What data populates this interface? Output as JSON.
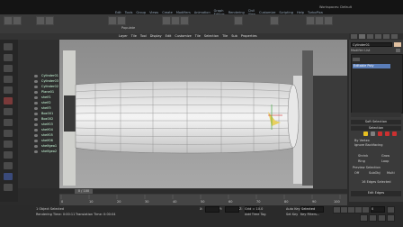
{
  "app": {
    "menu": [
      "Edit",
      "Tools",
      "Group",
      "Views",
      "Create",
      "Modifiers",
      "Animation",
      "Graph Editors",
      "Rendering",
      "Civil View",
      "Customize",
      "Scripting",
      "Help",
      "TurboPixa"
    ],
    "workspace_label": "Workspaces: Default",
    "populate_label": "Populate"
  },
  "viewport_menu": [
    "Layer",
    "Tile",
    "Tool",
    "Display",
    "Edit",
    "Customize",
    "Tile",
    "Selection",
    "Tile",
    "Sub",
    "Properties"
  ],
  "scene_explorer": {
    "items": [
      "Cylinder01",
      "Cylinder03",
      "Cylinder02",
      "Plane01",
      "shelf1",
      "shelf2",
      "shelf3",
      "Box001",
      "Box002",
      "shelf03",
      "shelf04",
      "shelf05",
      "shelf06",
      "shelfgeo1",
      "shelfgeo2"
    ]
  },
  "command_panel": {
    "object_name": "Cylinder01",
    "modifier_list_label": "Modifier List",
    "stack_selected": "Editable Poly",
    "soft_selection": "Soft Selection",
    "selection": "Selection",
    "by_vertex": "By Vertex",
    "ignore_backfacing": "Ignore Backfacing",
    "shrink": "Shrink",
    "grow": "Grow",
    "ring": "Ring",
    "loop": "Loop",
    "preview_selection": "Preview Selection",
    "off": "Off",
    "subobj": "SubObj",
    "multi": "Multi",
    "selected_count": "16 Edges Selected",
    "edit_edges": "Edit Edges",
    "icon_colors": [
      "#e8c020",
      "#808080",
      "#cc3030",
      "#cc3030",
      "#cc3030"
    ]
  },
  "timeline": {
    "frame_display": "0 / 100",
    "ticks": [
      "0",
      "10",
      "20",
      "30",
      "40",
      "50",
      "60",
      "70",
      "80",
      "90",
      "100"
    ]
  },
  "status": {
    "selection_count": "1 Object Selected",
    "render_time": "Rendering Time: 0:00:11",
    "translation_time": "Translation Time: 0:00:04",
    "grid": "Grid = 10.0",
    "add_time_tag": "Add Time Tag",
    "auto_key": "Auto Key",
    "set_key": "Set Key",
    "selected_dropdown": "Selected",
    "key_filters": "Key Filters...",
    "frame_field": "0",
    "x_label": "X:",
    "y_label": "Y:",
    "z_label": "Z:"
  }
}
